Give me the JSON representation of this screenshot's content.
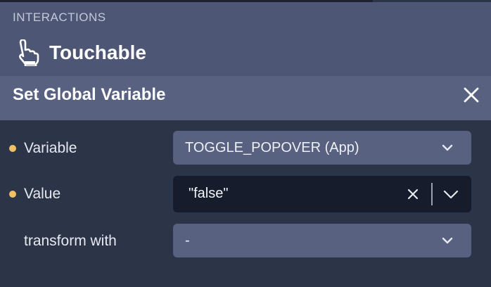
{
  "section": {
    "label": "INTERACTIONS"
  },
  "trigger": {
    "title": "Touchable",
    "icon": "hand-pointer-icon"
  },
  "action": {
    "title": "Set Global Variable",
    "close_icon": "close-icon"
  },
  "properties": [
    {
      "label": "Variable",
      "required": true,
      "value": "TOGGLE_POPOVER (App)",
      "control": "select"
    },
    {
      "label": "Value",
      "required": true,
      "value": "\"false\"",
      "control": "combobox"
    },
    {
      "label": "transform with",
      "required": false,
      "value": "-",
      "control": "select"
    }
  ],
  "colors": {
    "required_dot": "#f2c063",
    "section_bg": "#4d5675",
    "header_bg": "#586180",
    "body_bg": "#2c3448",
    "select_bg": "#58617f",
    "value_bg": "#161c2b"
  }
}
